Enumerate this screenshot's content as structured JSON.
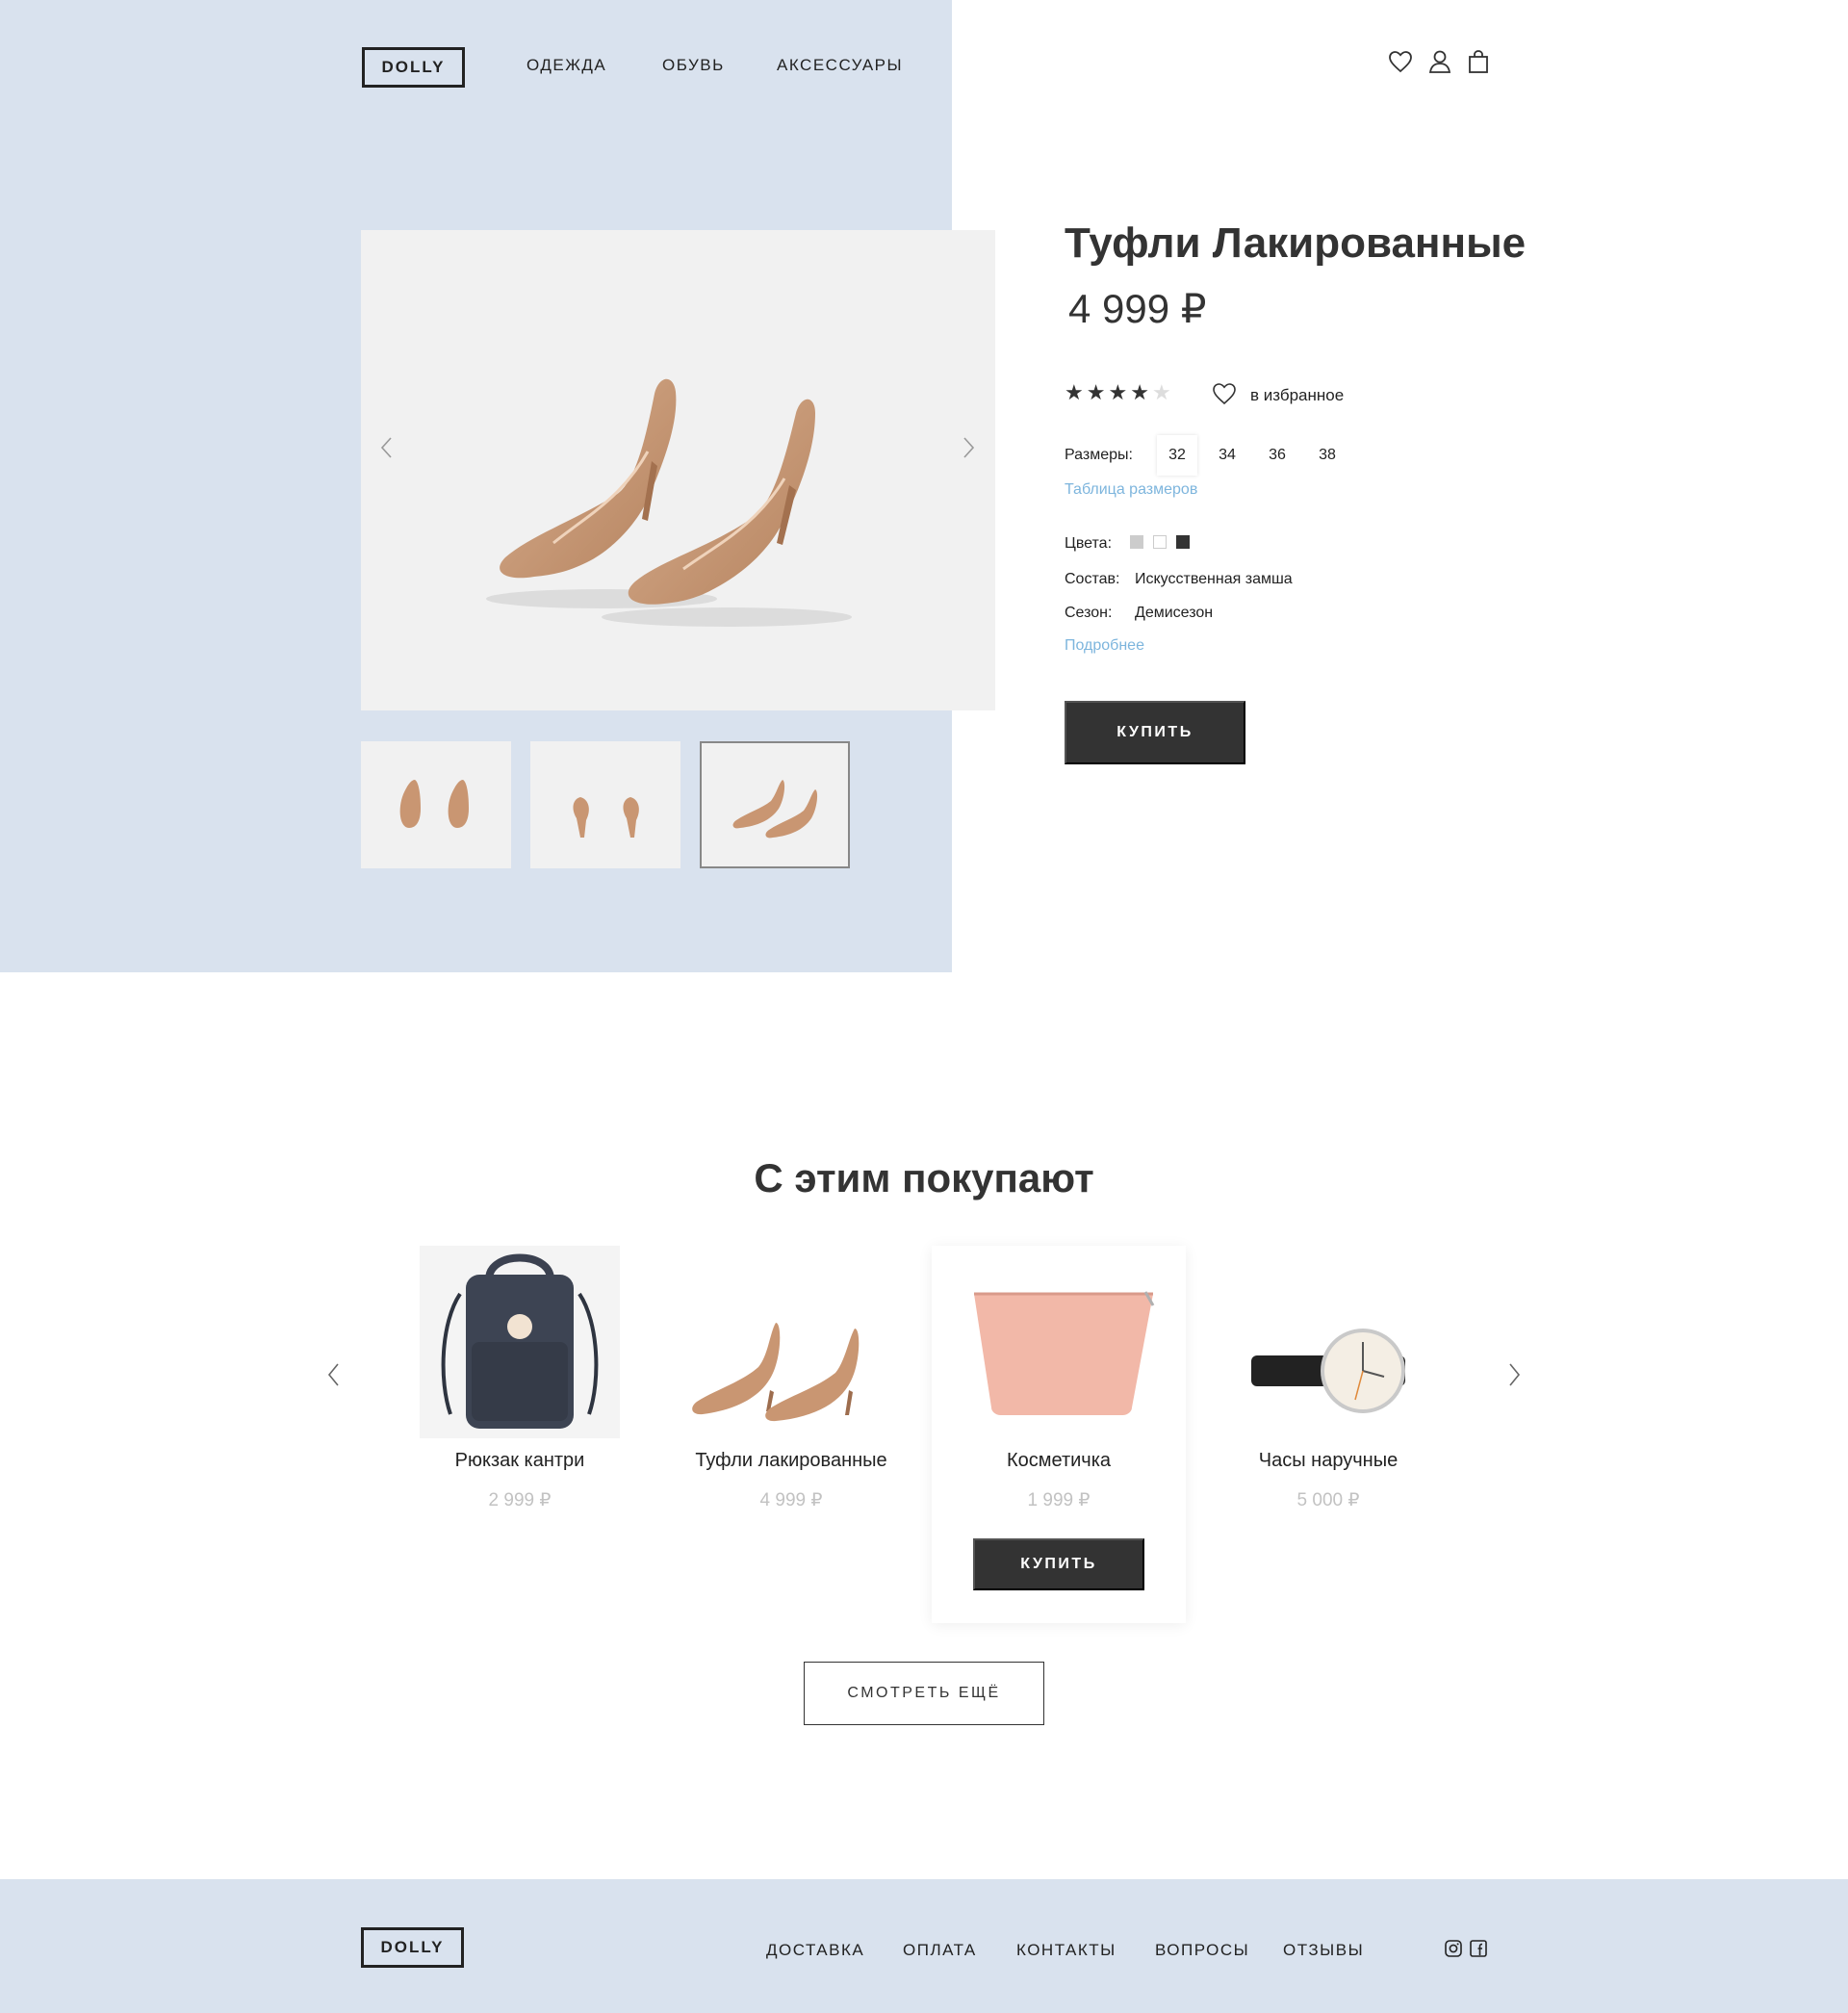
{
  "header": {
    "logo": "DOLLY",
    "nav": [
      "ОДЕЖДА",
      "ОБУВЬ",
      "АКСЕССУАРЫ"
    ],
    "icons": [
      "heart-icon",
      "user-icon",
      "shopping-bag-icon"
    ]
  },
  "product": {
    "title": "Туфли Лакированные",
    "price": "4 999 ₽",
    "rating": 4,
    "rating_max": 5,
    "favorite_label": "в избранное",
    "sizes_label": "Размеры:",
    "sizes": [
      "32",
      "34",
      "36",
      "38"
    ],
    "selected_size": "32",
    "size_chart_link": "Таблица размеров",
    "colors_label": "Цвета:",
    "colors": [
      "#cccccc",
      "#ffffff",
      "#333333"
    ],
    "composition_label": "Состав:",
    "composition": "Искусственная замша",
    "season_label": "Сезон:",
    "season": "Демисезон",
    "details_link": "Подробнее",
    "buy_label": "КУПИТЬ"
  },
  "related": {
    "title": "С этим покупают",
    "items": [
      {
        "name": "Рюкзак кантри",
        "price": "2 999 ₽"
      },
      {
        "name": "Туфли лакированные",
        "price": "4 999 ₽"
      },
      {
        "name": "Косметичка",
        "price": "1 999 ₽",
        "buy": "КУПИТЬ"
      },
      {
        "name": "Часы наручные",
        "price": "5 000 ₽"
      }
    ],
    "more_label": "СМОТРЕТЬ ЕЩЁ"
  },
  "footer": {
    "logo": "DOLLY",
    "links": [
      "ДОСТАВКА",
      "ОПЛАТА",
      "КОНТАКТЫ",
      "ВОПРОСЫ",
      "ОТЗЫВЫ"
    ],
    "social": [
      "instagram-icon",
      "facebook-icon"
    ]
  },
  "colors": {
    "panel": "#d9e2ee",
    "dark_button": "#333333",
    "link": "#7db5dd",
    "muted_price": "#c2c2c2"
  }
}
